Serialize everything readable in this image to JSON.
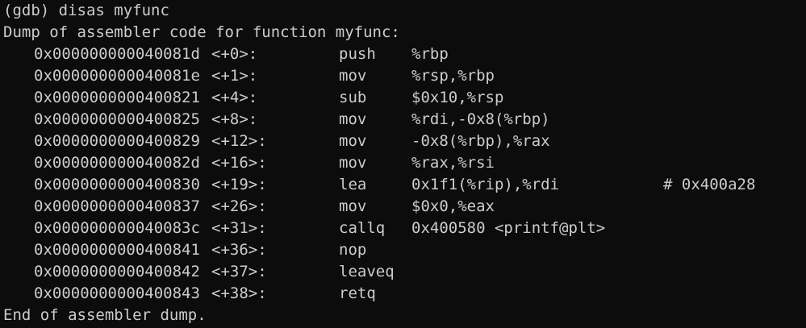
{
  "prompt_line": "(gdb) disas myfunc",
  "header_line": "Dump of assembler code for function myfunc:",
  "instructions": [
    {
      "address": "0x000000000040081d",
      "offset": "<+0>:",
      "mnemonic": "push",
      "operands": "%rbp",
      "comment": ""
    },
    {
      "address": "0x000000000040081e",
      "offset": "<+1>:",
      "mnemonic": "mov",
      "operands": "%rsp,%rbp",
      "comment": ""
    },
    {
      "address": "0x0000000000400821",
      "offset": "<+4>:",
      "mnemonic": "sub",
      "operands": "$0x10,%rsp",
      "comment": ""
    },
    {
      "address": "0x0000000000400825",
      "offset": "<+8>:",
      "mnemonic": "mov",
      "operands": "%rdi,-0x8(%rbp)",
      "comment": ""
    },
    {
      "address": "0x0000000000400829",
      "offset": "<+12>:",
      "mnemonic": "mov",
      "operands": "-0x8(%rbp),%rax",
      "comment": ""
    },
    {
      "address": "0x000000000040082d",
      "offset": "<+16>:",
      "mnemonic": "mov",
      "operands": "%rax,%rsi",
      "comment": ""
    },
    {
      "address": "0x0000000000400830",
      "offset": "<+19>:",
      "mnemonic": "lea",
      "operands": "0x1f1(%rip),%rdi",
      "comment": "# 0x400a28"
    },
    {
      "address": "0x0000000000400837",
      "offset": "<+26>:",
      "mnemonic": "mov",
      "operands": "$0x0,%eax",
      "comment": ""
    },
    {
      "address": "0x000000000040083c",
      "offset": "<+31>:",
      "mnemonic": "callq",
      "operands": "0x400580 <printf@plt>",
      "comment": ""
    },
    {
      "address": "0x0000000000400841",
      "offset": "<+36>:",
      "mnemonic": "nop",
      "operands": "",
      "comment": ""
    },
    {
      "address": "0x0000000000400842",
      "offset": "<+37>:",
      "mnemonic": "leaveq",
      "operands": "",
      "comment": ""
    },
    {
      "address": "0x0000000000400843",
      "offset": "<+38>:",
      "mnemonic": "retq",
      "operands": "",
      "comment": ""
    }
  ],
  "footer_line": "End of assembler dump.",
  "colors": {
    "background": "#0c0c0c",
    "foreground": "#cccccc"
  }
}
